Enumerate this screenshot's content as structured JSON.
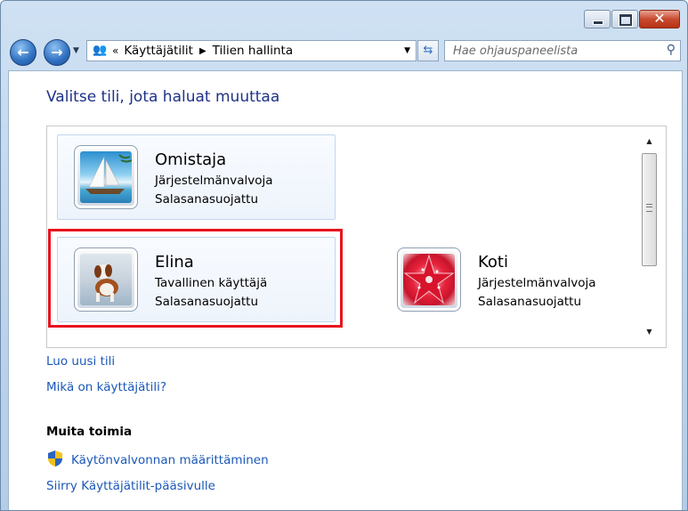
{
  "navigation": {
    "breadcrumb": [
      "Käyttäjätilit",
      "Tilien hallinta"
    ],
    "search_placeholder": "Hae ohjauspaneelista"
  },
  "main": {
    "title": "Valitse tili, jota haluat muuttaa",
    "accounts": [
      {
        "name": "Omistaja",
        "role": "Järjestelmänvalvoja",
        "password": "Salasanasuojattu",
        "picture": "sailboat"
      },
      {
        "name": "Elina",
        "role": "Tavallinen käyttäjä",
        "password": "Salasanasuojattu",
        "picture": "dog",
        "highlighted": true
      },
      {
        "name": "Koti",
        "role": "Järjestelmänvalvoja",
        "password": "Salasanasuojattu",
        "picture": "red-starfish"
      }
    ],
    "links": {
      "create_account": "Luo uusi tili",
      "what_is_account": "Mikä on käyttäjätili?"
    },
    "other_actions": {
      "heading": "Muita toimia",
      "uac": "Käytönvalvonnan määrittäminen",
      "goto_main": "Siirry Käyttäjätilit-pääsivulle"
    }
  },
  "colors": {
    "highlight": "#e8141f",
    "link": "#1b58b8",
    "title": "#1e3287"
  }
}
